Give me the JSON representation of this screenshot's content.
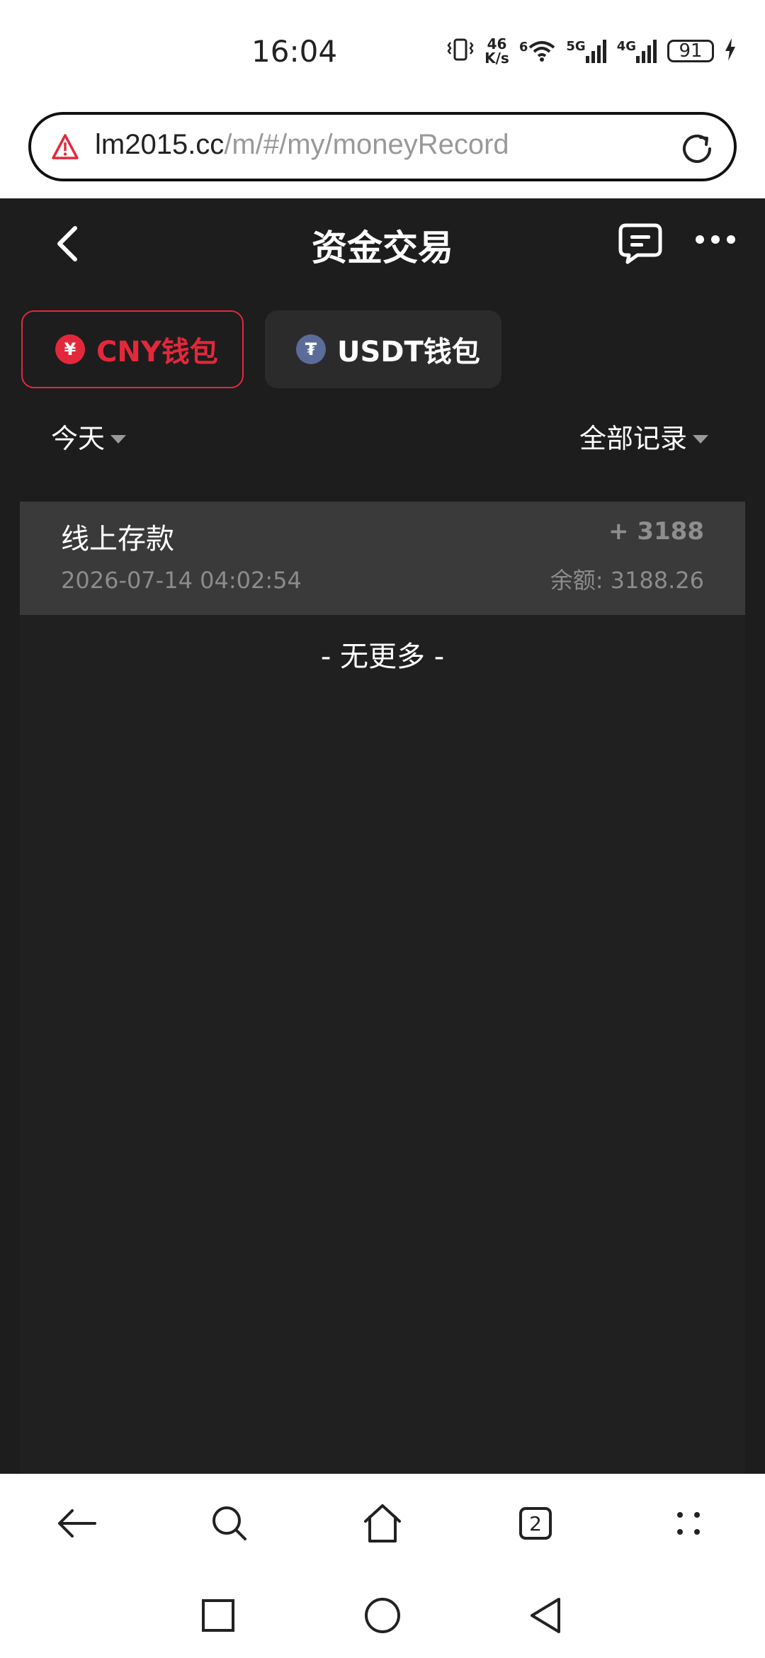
{
  "status_bar": {
    "time": "16:04",
    "net_speed_top": "46",
    "net_speed_bottom": "K/s",
    "wifi_badge": "6",
    "sig1_label": "5G",
    "sig2_label": "4G",
    "battery": "91"
  },
  "url_bar": {
    "host": "lm2015.cc",
    "path": "/m/#/my/moneyRecord"
  },
  "header": {
    "title": "资金交易"
  },
  "wallets": [
    {
      "label": "CNY钱包",
      "coin_symbol": "¥",
      "active": true
    },
    {
      "label": "USDT钱包",
      "coin_symbol": "₮",
      "active": false
    }
  ],
  "filters": {
    "date": "今天",
    "type": "全部记录"
  },
  "records": [
    {
      "title": "线上存款",
      "time": "2026-07-14 04:02:54",
      "amount": "+ 3188",
      "balance_label": "余额:",
      "balance": "3188.26"
    }
  ],
  "no_more_text": "- 无更多 -",
  "browser_toolbar": {
    "tab_count": "2"
  },
  "colors": {
    "accent_red": "#e4283b",
    "app_bg": "#1d1d1d",
    "record_bg": "#3a3a3a"
  }
}
